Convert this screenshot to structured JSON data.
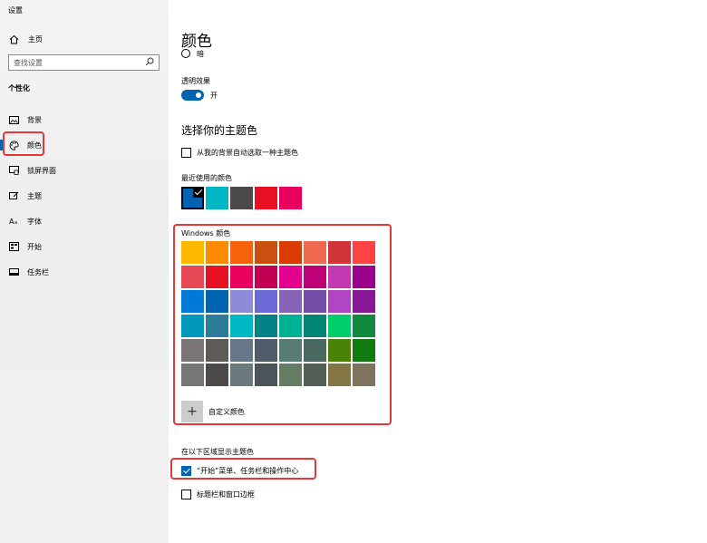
{
  "window": {
    "title": "设置"
  },
  "sidebar": {
    "home_label": "主页",
    "search_placeholder": "查找设置",
    "section_label": "个性化",
    "items": [
      {
        "label": "背景",
        "icon": "picture-icon"
      },
      {
        "label": "颜色",
        "icon": "palette-icon",
        "selected": true
      },
      {
        "label": "锁屏界面",
        "icon": "lock-screen-icon"
      },
      {
        "label": "主题",
        "icon": "theme-icon"
      },
      {
        "label": "字体",
        "icon": "font-icon"
      },
      {
        "label": "开始",
        "icon": "start-icon"
      },
      {
        "label": "任务栏",
        "icon": "taskbar-icon"
      }
    ]
  },
  "main": {
    "title": "颜色",
    "mode_radio_label": "暗",
    "transparency_label": "透明效果",
    "transparency_state": "开",
    "accent_title": "选择你的主题色",
    "auto_pick_label": "从我的背景自动选取一种主题色",
    "recent_label": "最近使用的颜色",
    "recent_colors": [
      "#0063b1",
      "#00b7c3",
      "#4c4a48",
      "#e81123",
      "#ea005e"
    ],
    "windows_colors_label": "Windows 颜色",
    "windows_colors": [
      [
        "#ffb900",
        "#ff8c00",
        "#f7630c",
        "#ca5010",
        "#da3b01",
        "#ef6950",
        "#d13438",
        "#ff4343"
      ],
      [
        "#e74856",
        "#e81123",
        "#ea005e",
        "#c30052",
        "#e3008c",
        "#bf0077",
        "#c239b3",
        "#9a0089"
      ],
      [
        "#0078d7",
        "#0063b1",
        "#8e8cd8",
        "#6b69d6",
        "#8764b8",
        "#744da9",
        "#b146c2",
        "#881798"
      ],
      [
        "#0099bc",
        "#2d7d9a",
        "#00b7c3",
        "#038387",
        "#00b294",
        "#018574",
        "#00cc6a",
        "#10893e"
      ],
      [
        "#7a7574",
        "#5d5a58",
        "#68768a",
        "#515c6b",
        "#567c73",
        "#486860",
        "#498205",
        "#107c10"
      ],
      [
        "#767676",
        "#4c4a48",
        "#69797e",
        "#4a5459",
        "#647c64",
        "#525e54",
        "#847545",
        "#7e735f"
      ]
    ],
    "custom_color_label": "自定义颜色",
    "show_on_label": "在以下区域显示主题色",
    "show_start_label": "“开始”菜单、任务栏和操作中心",
    "show_titlebar_label": "标题栏和窗口边框"
  },
  "colors": {
    "accent": "#0063b1",
    "highlight": "#e53935"
  }
}
